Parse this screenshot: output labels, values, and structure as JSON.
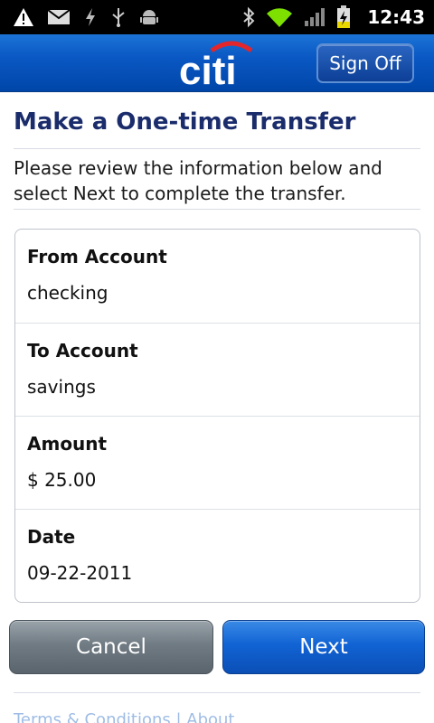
{
  "status_bar": {
    "time": "12:43",
    "icons": [
      "warning-icon",
      "mail-icon",
      "charge-icon",
      "usb-icon",
      "android-icon",
      "bluetooth-icon",
      "wifi-icon",
      "signal-icon",
      "battery-icon"
    ]
  },
  "header": {
    "logo": "citi",
    "sign_off_label": "Sign Off",
    "brand_color": "#0a58c4"
  },
  "page": {
    "title": "Make a One-time Transfer",
    "instructions": "Please review the information below and select Next to complete the transfer."
  },
  "transfer_details": [
    {
      "label": "From Account",
      "value": "checking"
    },
    {
      "label": "To Account",
      "value": "savings"
    },
    {
      "label": "Amount",
      "value": "$ 25.00"
    },
    {
      "label": "Date",
      "value": "09-22-2011"
    }
  ],
  "actions": {
    "cancel_label": "Cancel",
    "next_label": "Next"
  },
  "footer": {
    "terms_link": "Terms & Conditions | About"
  }
}
